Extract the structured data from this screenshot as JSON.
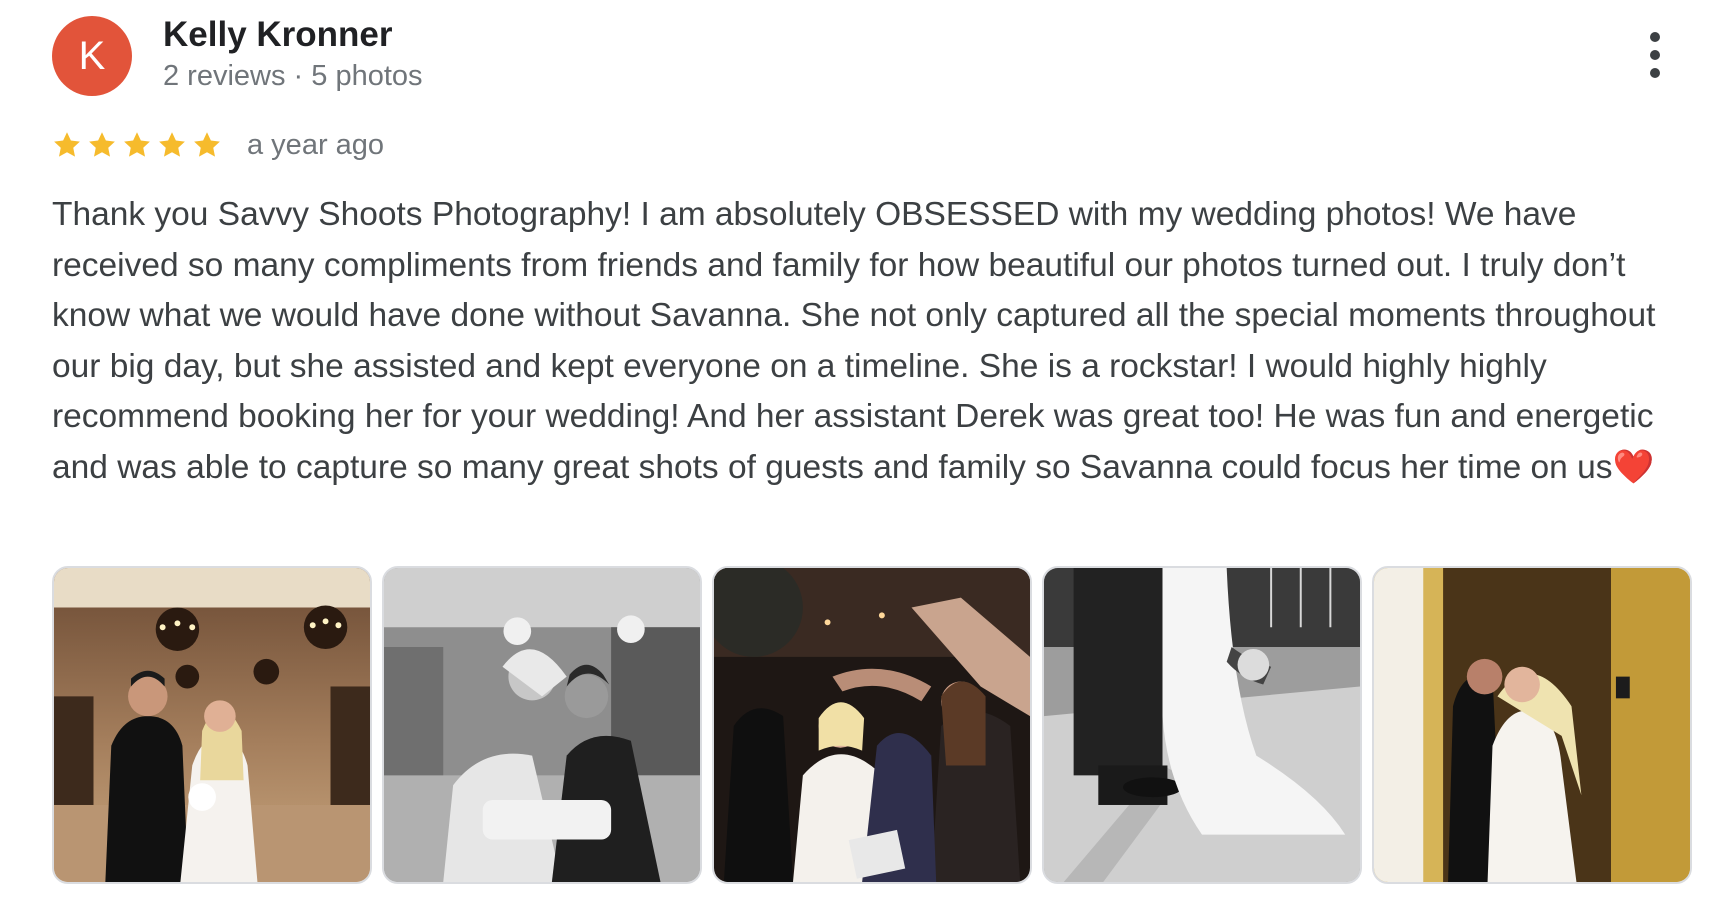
{
  "author": {
    "initial": "K",
    "avatar_color": "#e2543a",
    "name": "Kelly Kronner",
    "meta": "2 reviews · 5 photos"
  },
  "review": {
    "rating": 5,
    "max_rating": 5,
    "star_color": "#f6bb2c",
    "time_ago": "a year ago",
    "text": "Thank you Savvy Shoots Photography! I am absolutely OBSESSED with my wedding photos! We have received so many compliments from friends and family for how beautiful our photos turned out. I truly don’t know what we would have done without Savanna. She not only captured all the special moments throughout our big day, but she assisted and kept everyone on a timeline. She is a rockstar! I would highly highly recommend booking her for your wedding! And her assistant Derek was great too! He was fun and energetic and was able to capture so many great shots of guests and family so Savanna could focus her time on us❤️"
  },
  "menu": {
    "icon": "more-vert-icon"
  },
  "photos": [
    {
      "scene": "couple-ballroom-chandeliers-color"
    },
    {
      "scene": "couple-kiss-sofa-black-and-white"
    },
    {
      "scene": "sparkler-exit-crowd-color"
    },
    {
      "scene": "bride-dress-feet-marble-black-and-white"
    },
    {
      "scene": "couple-elevator-kiss-gold-color"
    }
  ]
}
